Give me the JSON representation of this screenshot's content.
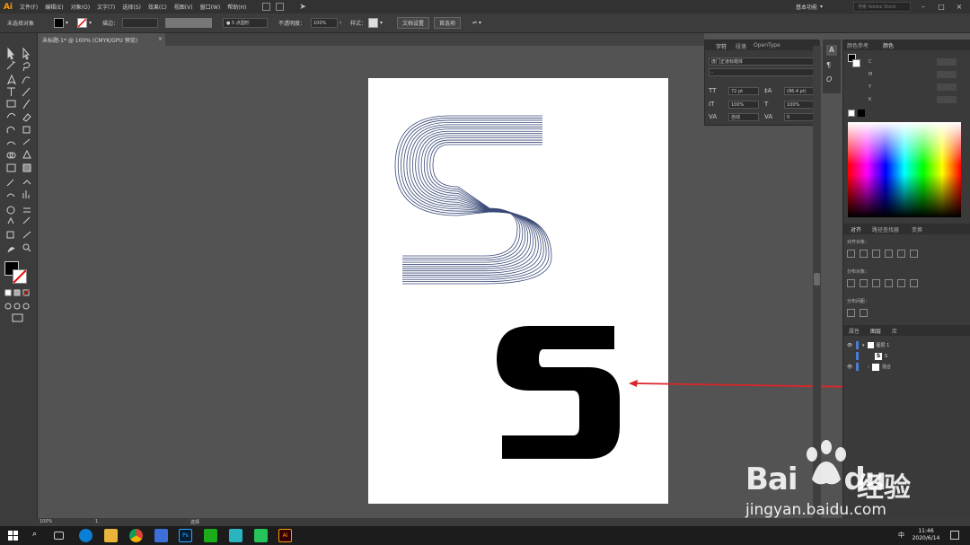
{
  "app": {
    "logo": "Ai",
    "menus": [
      "文件(F)",
      "编辑(E)",
      "对象(O)",
      "文字(T)",
      "选择(S)",
      "效果(C)",
      "视图(V)",
      "窗口(W)",
      "帮助(H)"
    ],
    "workspace": "基本功能",
    "search_placeholder": "搜索 Adobe Stock"
  },
  "control_bar": {
    "selection_label": "未选择对象",
    "stroke_label": "描边：",
    "brush_label": "5 点圆形",
    "opacity_label": "不透明度：",
    "opacity_value": "100%",
    "style_label": "样式：",
    "doc_setup_button": "文档设置",
    "preferences_button": "首选项"
  },
  "document_tab": {
    "title": "未标题-1* @ 100% (CMYK/GPU 预览)",
    "close": "×"
  },
  "character_panel": {
    "tabs": [
      "字符",
      "段落",
      "OpenType"
    ],
    "font_family": "庞门正道标题体",
    "font_style": "-",
    "font_size": "72 pt",
    "leading": "(86.4 pt)",
    "vertical_scale": "100%",
    "horizontal_scale": "100%",
    "kerning": "自动",
    "tracking": "0"
  },
  "color_panel": {
    "tabs": [
      "颜色参考",
      "颜色"
    ],
    "labels": [
      "C",
      "M",
      "Y",
      "K"
    ]
  },
  "align_panel": {
    "tabs": [
      "对齐",
      "路径查找器",
      "变换"
    ],
    "section_align": "对齐对象：",
    "section_distribute": "分布对象：",
    "section_spacing": "分布间距："
  },
  "layers_panel": {
    "tabs": [
      "属性",
      "图层",
      "库"
    ],
    "layer_name": "图层 1",
    "items": [
      "S",
      "混合"
    ]
  },
  "artwork": {
    "glyph": "S"
  },
  "status_bar": {
    "zoom": "100%",
    "page": "1",
    "tool": "选择"
  },
  "taskbar": {
    "time": "11:46",
    "date": "2020/6/14",
    "ime": "中"
  },
  "watermark": {
    "brand": "Bai",
    "brand_suffix": "du",
    "cn_text": "经验",
    "url": "jingyan.baidu.com"
  },
  "colors": {
    "arrow": "#d9262a",
    "accent_ai": "#ff9a00",
    "panel_bg": "#3a3a3a",
    "canvas_bg": "#535353"
  }
}
